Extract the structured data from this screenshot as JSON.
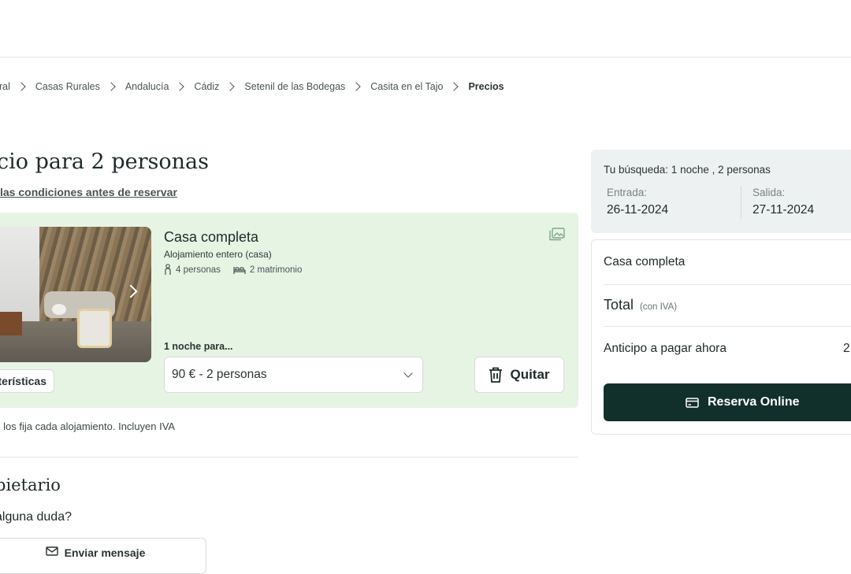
{
  "breadcrumb": [
    "ural",
    "Casas Rurales",
    "Andalucía",
    "Cádiz",
    "Setenil de las Bodegas",
    "Casita en el Tajo",
    "Precios"
  ],
  "page": {
    "title": "cio para 2 personas",
    "conditions_link": "las condiciones antes de reservar"
  },
  "offer": {
    "name": "Casa completa",
    "type": "Alojamiento entero (casa)",
    "guests": "4 personas",
    "beds": "2 matrimonio",
    "nights_label": "1 noche para...",
    "selected_option": "90 € - 2 personas",
    "remove_label": "Quitar",
    "features_label": "terísticas"
  },
  "note": "s los fija cada alojamiento. Incluyen IVA",
  "owner": {
    "title": "pietario",
    "question": "alguna duda?",
    "message_button": "Enviar mensaje"
  },
  "search": {
    "summary": "Tu búsqueda: 1 noche , 2 personas",
    "checkin_label": "Entrada:",
    "checkin_value": "26-11-2024",
    "checkout_label": "Salida:",
    "checkout_value": "27-11-2024"
  },
  "summary": {
    "item": "Casa completa",
    "total_label": "Total",
    "total_note": "(con IVA)",
    "deposit_label": "Anticipo a pagar ahora",
    "deposit_value": "2",
    "reserve_button": "Reserva Online"
  },
  "icons": {
    "breadcrumb_separator": "chevron-right-icon",
    "gallery": "image-gallery-icon",
    "guests": "person-icon",
    "beds": "bed-icon",
    "select": "chevron-down-icon",
    "remove": "trash-icon",
    "reserve": "credit-card-icon",
    "message": "envelope-icon"
  },
  "colors": {
    "offer_background": "#e6f4e3",
    "reserve_button": "#11302c",
    "search_background": "#eef1f2"
  }
}
